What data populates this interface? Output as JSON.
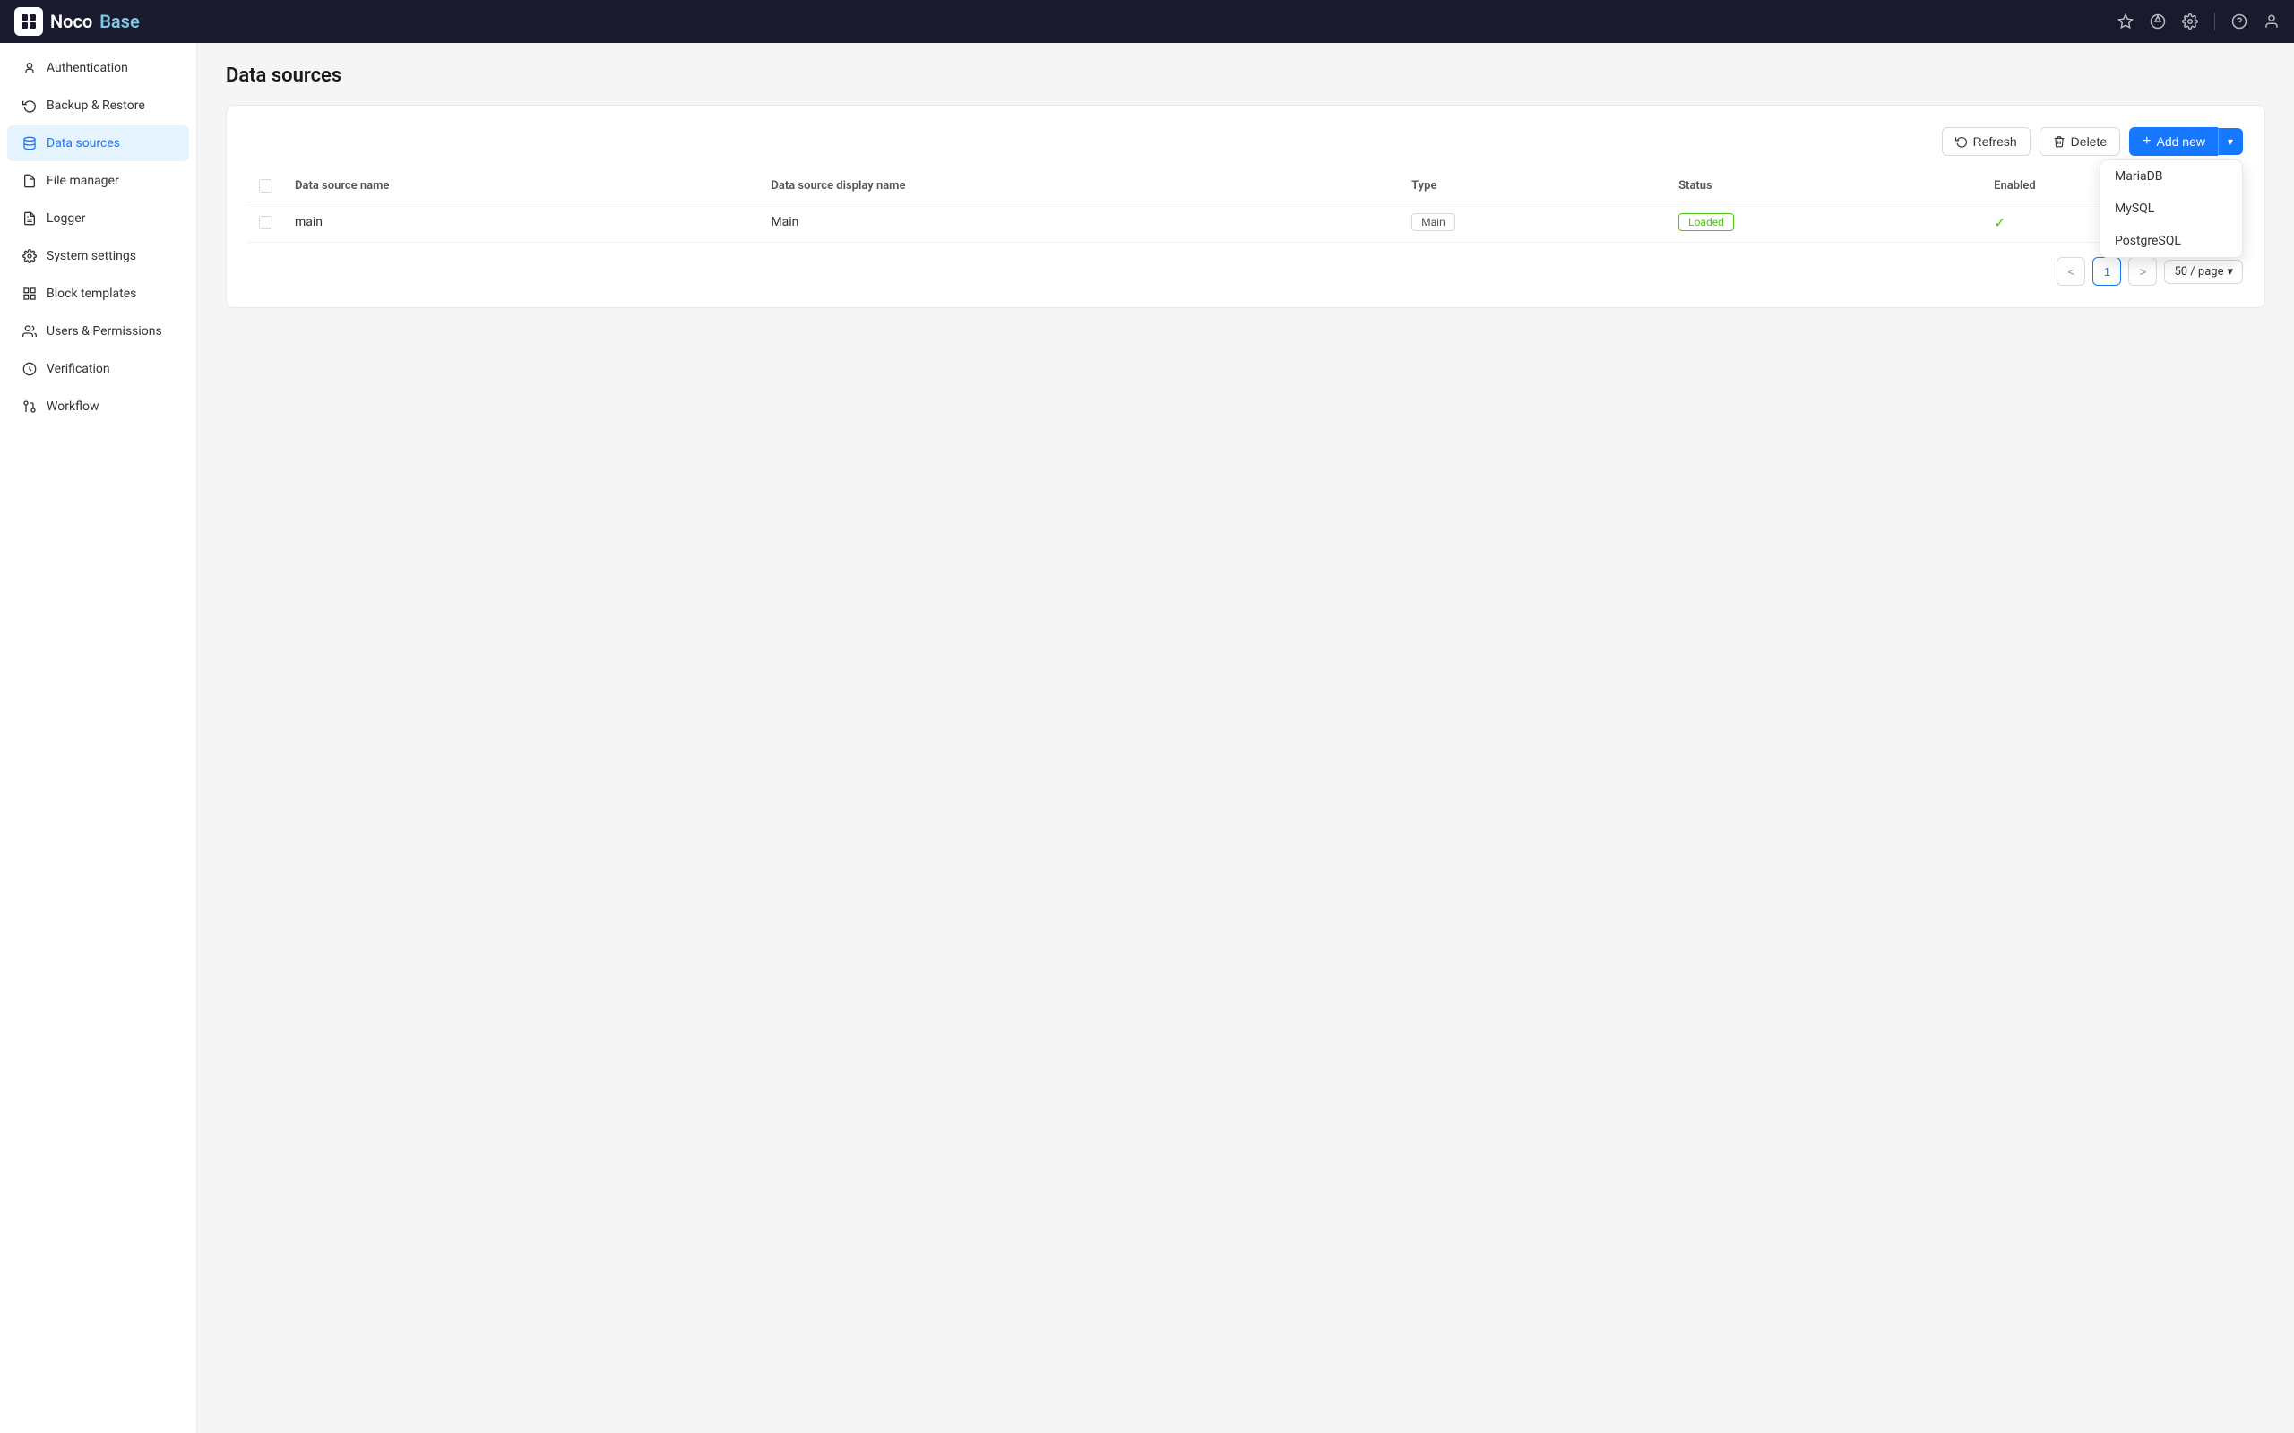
{
  "app": {
    "name_part1": "Noco",
    "name_part2": "Base"
  },
  "navbar": {
    "icons": [
      "pin-icon",
      "rocket-icon",
      "gear-icon",
      "help-icon",
      "user-icon"
    ]
  },
  "sidebar": {
    "items": [
      {
        "id": "authentication",
        "label": "Authentication",
        "icon": "auth-icon"
      },
      {
        "id": "backup-restore",
        "label": "Backup & Restore",
        "icon": "backup-icon"
      },
      {
        "id": "data-sources",
        "label": "Data sources",
        "icon": "datasource-icon",
        "active": true
      },
      {
        "id": "file-manager",
        "label": "File manager",
        "icon": "file-icon"
      },
      {
        "id": "logger",
        "label": "Logger",
        "icon": "logger-icon"
      },
      {
        "id": "system-settings",
        "label": "System settings",
        "icon": "settings-icon"
      },
      {
        "id": "block-templates",
        "label": "Block templates",
        "icon": "block-icon"
      },
      {
        "id": "users-permissions",
        "label": "Users & Permissions",
        "icon": "users-icon"
      },
      {
        "id": "verification",
        "label": "Verification",
        "icon": "verify-icon"
      },
      {
        "id": "workflow",
        "label": "Workflow",
        "icon": "workflow-icon"
      }
    ]
  },
  "page": {
    "title": "Data sources"
  },
  "toolbar": {
    "refresh_label": "Refresh",
    "delete_label": "Delete",
    "add_new_label": "Add new"
  },
  "dropdown": {
    "items": [
      "MariaDB",
      "MySQL",
      "PostgreSQL"
    ]
  },
  "table": {
    "columns": [
      "Data source name",
      "Data source display name",
      "Type",
      "Status",
      "Enabled"
    ],
    "rows": [
      {
        "index": "1",
        "name": "main",
        "display_name": "Main",
        "type": "Main",
        "status": "Loaded",
        "enabled": true
      }
    ]
  },
  "pagination": {
    "current_page": "1",
    "prev_label": "<",
    "next_label": ">",
    "per_page_label": "50 / page"
  }
}
